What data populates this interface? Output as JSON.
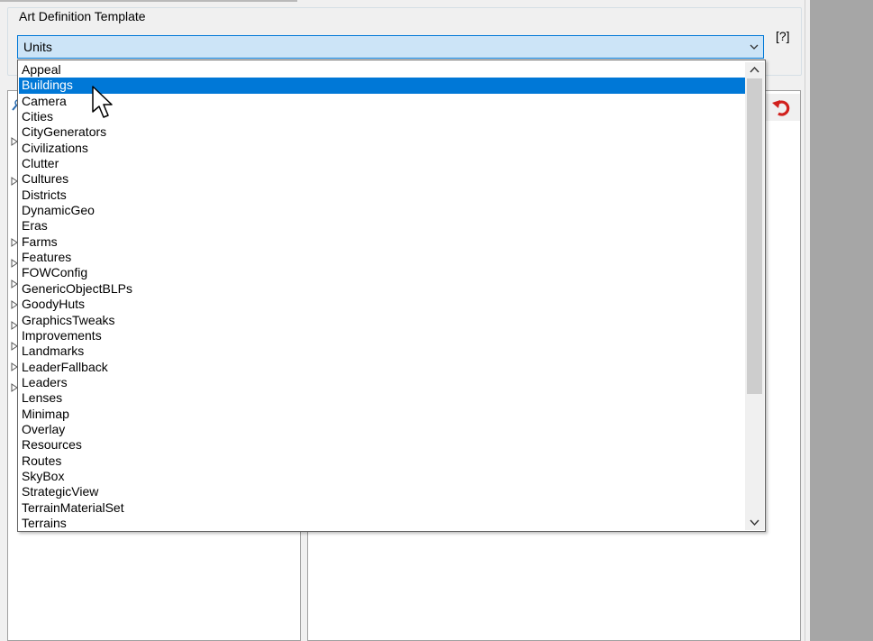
{
  "group": {
    "title": "Art Definition Template",
    "help_label": "[?]"
  },
  "combo": {
    "selected_value": "Units"
  },
  "dropdown": {
    "items": [
      "Appeal",
      "Buildings",
      "Camera",
      "Cities",
      "CityGenerators",
      "Civilizations",
      "Clutter",
      "Cultures",
      "Districts",
      "DynamicGeo",
      "Eras",
      "Farms",
      "Features",
      "FOWConfig",
      "GenericObjectBLPs",
      "GoodyHuts",
      "GraphicsTweaks",
      "Improvements",
      "Landmarks",
      "LeaderFallback",
      "Leaders",
      "Lenses",
      "Minimap",
      "Overlay",
      "Resources",
      "Routes",
      "SkyBox",
      "StrategicView",
      "TerrainMaterialSet",
      "Terrains"
    ],
    "highlighted_index": 1
  },
  "colors": {
    "selection": "#0078d7",
    "combo_background": "#cce4f7",
    "window_background": "#f0f0f0"
  },
  "icons": [
    "chevron-down-icon",
    "undo-icon",
    "scroll-up-icon",
    "scroll-down-icon",
    "expander-arrow-icon",
    "mouse-cursor-icon"
  ]
}
